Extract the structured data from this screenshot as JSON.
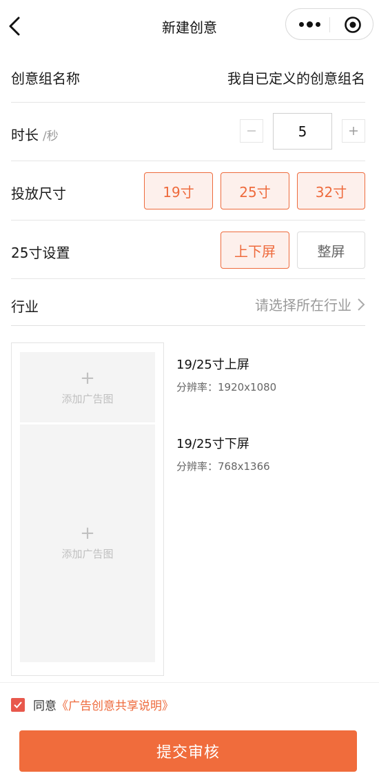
{
  "nav": {
    "title": "新建创意"
  },
  "form": {
    "group_name": {
      "label": "创意组名称",
      "value": "我自已定义的创意组名"
    },
    "duration": {
      "label": "时长",
      "unit": "/秒",
      "value": "5"
    },
    "size": {
      "label": "投放尺寸",
      "options": [
        "19寸",
        "25寸",
        "32寸"
      ],
      "selected": [
        "19寸",
        "25寸",
        "32寸"
      ]
    },
    "setting25": {
      "label": "25寸设置",
      "options": [
        "上下屏",
        "整屏"
      ],
      "selected": "上下屏"
    },
    "industry": {
      "label": "行业",
      "placeholder": "请选择所在行业"
    }
  },
  "images": {
    "add_label": "添加广告图",
    "specs": [
      {
        "title": "19/25寸上屏",
        "resolution": "分辨率：1920x1080"
      },
      {
        "title": "19/25寸下屏",
        "resolution": "分辨率：768x1366"
      }
    ]
  },
  "footer": {
    "agree_checked": true,
    "agree_text": "同意",
    "agree_link": "《广告创意共享说明》",
    "submit_label": "提交审核"
  },
  "colors": {
    "accent": "#f06c3c",
    "accent_light": "#fdf0ec",
    "checkbox": "#e8584c"
  },
  "icons": {
    "back": "chevron-left-icon",
    "more": "more-dots-icon",
    "close": "target-circle-icon",
    "industry_arrow": "chevron-right-icon",
    "add": "plus-icon"
  }
}
